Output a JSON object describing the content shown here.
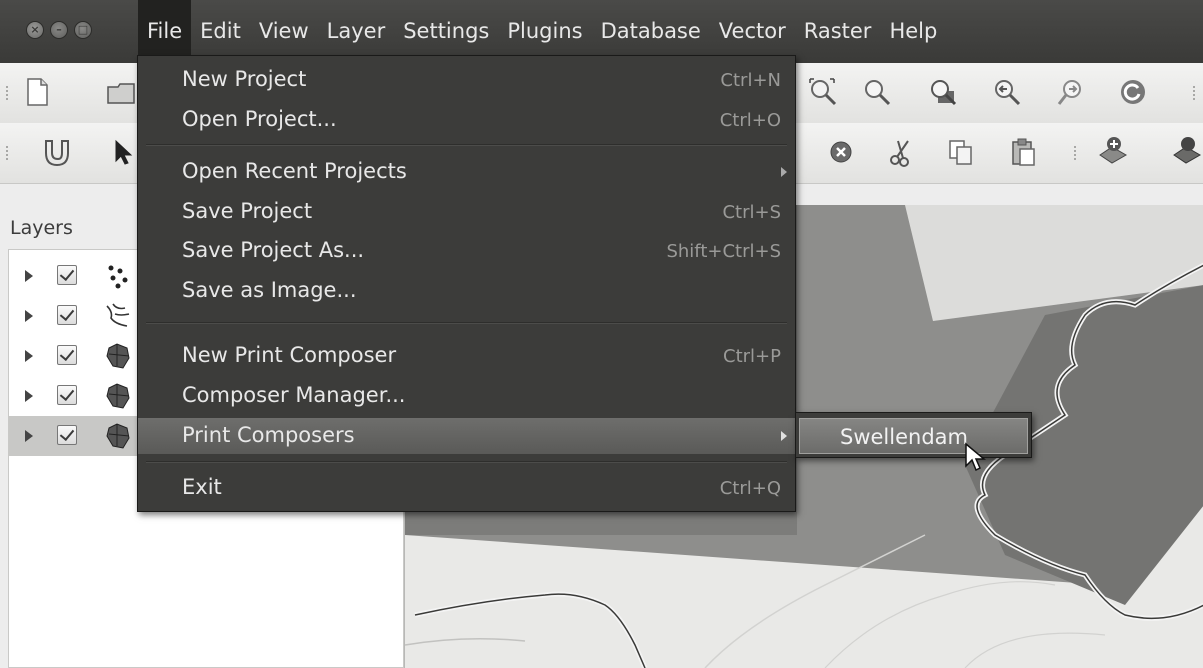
{
  "window": {
    "close_glyph": "×",
    "min_glyph": "–",
    "max_glyph": "□"
  },
  "menubar": {
    "items": [
      "File",
      "Edit",
      "View",
      "Layer",
      "Settings",
      "Plugins",
      "Database",
      "Vector",
      "Raster",
      "Help"
    ],
    "active": "File"
  },
  "layers_panel": {
    "title": "Layers",
    "layers": [
      {
        "symbol": "points-layer-icon",
        "checked": true
      },
      {
        "symbol": "lines-layer-icon",
        "checked": true
      },
      {
        "symbol": "polygon-layer-icon",
        "checked": true
      },
      {
        "symbol": "polygon-layer-icon",
        "checked": true
      },
      {
        "symbol": "polygon-layer-icon",
        "checked": true,
        "selected": true
      }
    ]
  },
  "file_menu": {
    "items": [
      {
        "label": "New Project",
        "shortcut": "Ctrl+N"
      },
      {
        "label": "Open Project...",
        "shortcut": "Ctrl+O"
      },
      {
        "label": "Open Recent Projects",
        "shortcut": "",
        "submenu": true
      },
      {
        "label": "Save Project",
        "shortcut": "Ctrl+S"
      },
      {
        "label": "Save Project As...",
        "shortcut": "Shift+Ctrl+S"
      },
      {
        "label": "Save as Image...",
        "shortcut": ""
      },
      {
        "label": "New Print Composer",
        "shortcut": "Ctrl+P"
      },
      {
        "label": "Composer Manager...",
        "shortcut": ""
      },
      {
        "label": "Print Composers",
        "shortcut": "",
        "submenu": true,
        "highlighted": true
      },
      {
        "label": "Exit",
        "shortcut": "Ctrl+Q"
      }
    ]
  },
  "print_composers_submenu": {
    "items": [
      "Swellendam"
    ],
    "hovered": "Swellendam"
  },
  "colors": {
    "menubar_bg": "#3c3c3a",
    "menu_text": "#e8e8e8",
    "highlight": "#6a6a68",
    "map_bg": "#e8e8e6"
  }
}
